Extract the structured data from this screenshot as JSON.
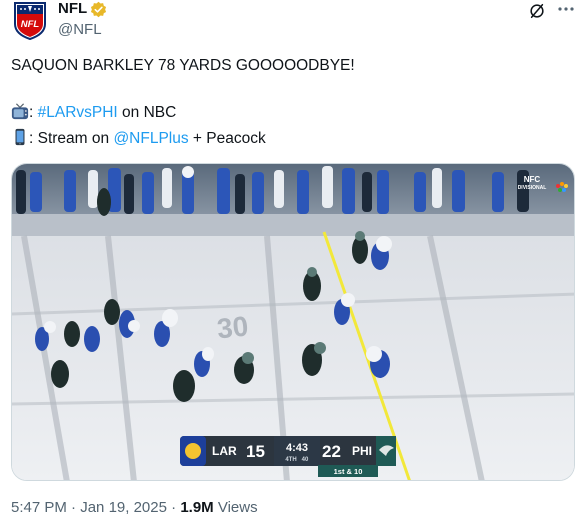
{
  "account": {
    "name": "NFL",
    "handle": "@NFL",
    "logo_text": "NFL"
  },
  "tweet": {
    "headline": "SAQUON BARKLEY 78 YARDS GOOOOODBYE!",
    "tv_prefix": ": ",
    "tv_hashtag": "#LARvsPHI",
    "tv_suffix": " on NBC",
    "stream_prefix": ": Stream on ",
    "stream_mention": "@NFLPlus",
    "stream_suffix": " + Peacock"
  },
  "scoreboard": {
    "away_team": "LAR",
    "away_score": "15",
    "clock": "4:43",
    "quarter": "4TH",
    "play_clock": "40",
    "home_team": "PHI",
    "home_score": "22",
    "down_distance": "1st & 10"
  },
  "broadcast_bug": {
    "line1": "NFC",
    "line2": "DIVISIONAL"
  },
  "field_numbers": {
    "left": "30"
  },
  "meta": {
    "time": "5:47 PM",
    "separator": " · ",
    "date": "Jan 19, 2025",
    "views_count": "1.9M",
    "views_label": " Views"
  },
  "colors": {
    "link": "#1d9bf0",
    "secondary_text": "#536471",
    "verified_gold": "#e8b829",
    "rams_blue": "#2a4fb0",
    "eagles_green": "#1f5a55",
    "first_down_line": "#f2e83a"
  },
  "icons": {
    "tv": "tv-emoji-icon",
    "phone": "mobile-phone-emoji-icon",
    "grok": "grok-icon",
    "more": "more-options-icon",
    "verified": "verified-badge-icon"
  }
}
